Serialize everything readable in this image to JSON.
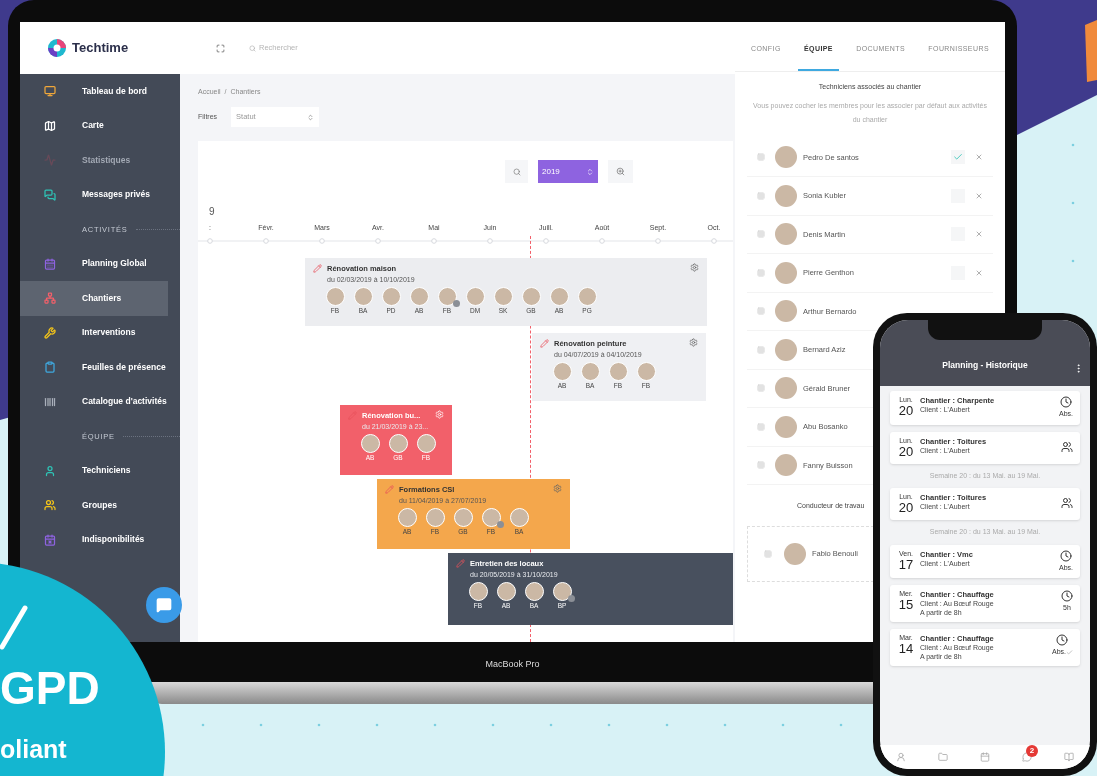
{
  "app": {
    "logo": "Techtime",
    "search_placeholder": "Rechercher"
  },
  "sidebar": {
    "items": [
      {
        "kind": "item",
        "label": "Tableau de bord",
        "selected": false,
        "disabled": false
      },
      {
        "kind": "item",
        "label": "Carte",
        "selected": false,
        "disabled": false
      },
      {
        "kind": "item",
        "label": "Statistiques",
        "selected": false,
        "disabled": true
      },
      {
        "kind": "item",
        "label": "Messages privés",
        "selected": false,
        "disabled": false
      },
      {
        "kind": "section",
        "label": "ACTIVITÉS"
      },
      {
        "kind": "item",
        "label": "Planning Global",
        "selected": false,
        "disabled": false
      },
      {
        "kind": "item",
        "label": "Chantiers",
        "selected": true,
        "disabled": false
      },
      {
        "kind": "item",
        "label": "Interventions",
        "selected": false,
        "disabled": false
      },
      {
        "kind": "item",
        "label": "Feuilles de présence",
        "selected": false,
        "disabled": false
      },
      {
        "kind": "item",
        "label": "Catalogue d'activités",
        "selected": false,
        "disabled": false
      },
      {
        "kind": "section",
        "label": "ÉQUIPE"
      },
      {
        "kind": "item",
        "label": "Techniciens",
        "selected": false,
        "disabled": false
      },
      {
        "kind": "item",
        "label": "Groupes",
        "selected": false,
        "disabled": false
      },
      {
        "kind": "item",
        "label": "Indisponibilités",
        "selected": false,
        "disabled": false
      }
    ]
  },
  "breadcrumb": {
    "items": [
      "Accueil",
      "Chantiers"
    ],
    "separator": "/"
  },
  "filters": {
    "label": "Filtres",
    "select": "Statut"
  },
  "gantt": {
    "year": "2019",
    "year_label": "9",
    "months": [
      ":",
      "Févr.",
      "Mars",
      "Avr.",
      "Mai",
      "Juin",
      "Juill.",
      "Août",
      "Sept.",
      "Oct."
    ],
    "bars": [
      {
        "title": "Rénovation maison",
        "dates": "du 02/03/2019 à 10/10/2019",
        "color": "#ecedf0",
        "gear": true,
        "people": [
          {
            "initials": "FB",
            "badge": false
          },
          {
            "initials": "BA",
            "badge": false
          },
          {
            "initials": "PD",
            "badge": false
          },
          {
            "initials": "AB",
            "badge": false
          },
          {
            "initials": "FB",
            "badge": true
          },
          {
            "initials": "DM",
            "badge": false
          },
          {
            "initials": "SK",
            "badge": false
          },
          {
            "initials": "GB",
            "badge": false
          },
          {
            "initials": "AB",
            "badge": false
          },
          {
            "initials": "PG",
            "badge": false
          }
        ]
      },
      {
        "title": "Rénovation peinture",
        "dates": "du 04/07/2019 à 04/10/2019",
        "color": "#eff0f3",
        "gear": true,
        "people": [
          {
            "initials": "AB",
            "badge": false
          },
          {
            "initials": "BA",
            "badge": false
          },
          {
            "initials": "FB",
            "badge": false
          },
          {
            "initials": "FB",
            "badge": false
          }
        ]
      },
      {
        "title": "Rénovation bu...",
        "dates": "du 21/03/2019 à 23...",
        "color": "#f2606a",
        "gear": true,
        "people": [
          {
            "initials": "AB",
            "badge": false
          },
          {
            "initials": "GB",
            "badge": false
          },
          {
            "initials": "FB",
            "badge": false
          }
        ]
      },
      {
        "title": "Formations CSI",
        "dates": "du 11/04/2019 à 27/07/2019",
        "color": "#f4a74c",
        "gear": true,
        "people": [
          {
            "initials": "AB",
            "badge": false
          },
          {
            "initials": "FB",
            "badge": false
          },
          {
            "initials": "GB",
            "badge": false
          },
          {
            "initials": "FB",
            "badge": true
          },
          {
            "initials": "BA",
            "badge": false
          }
        ]
      },
      {
        "title": "Entretien des locaux",
        "dates": "du 20/05/2019 à 31/10/2019",
        "color": "#48505e",
        "gear": false,
        "people": [
          {
            "initials": "FB",
            "badge": false
          },
          {
            "initials": "AB",
            "badge": false
          },
          {
            "initials": "BA",
            "badge": false
          },
          {
            "initials": "BP",
            "badge": true
          }
        ]
      }
    ]
  },
  "right_panel": {
    "tabs": [
      {
        "label": "CONFIG",
        "selected": false
      },
      {
        "label": "ÉQUIPE",
        "selected": true
      },
      {
        "label": "DOCUMENTS",
        "selected": false
      },
      {
        "label": "FOURNISSEURS",
        "selected": false
      }
    ],
    "heading": "Techniciens associés au chantier",
    "note": "Vous pouvez cocher les membres pour les associer par défaut aux activités du chantier",
    "members": [
      {
        "name": "Pedro De santos",
        "checked": true
      },
      {
        "name": "Sonia Kubler",
        "checked": false
      },
      {
        "name": "Denis Martin",
        "checked": false
      },
      {
        "name": "Pierre Genthon",
        "checked": false
      },
      {
        "name": "Arthur Bernardo"
      },
      {
        "name": "Bernard Aziz"
      },
      {
        "name": "Gérald Bruner"
      },
      {
        "name": "Abu Bosanko"
      },
      {
        "name": "Fanny Buisson"
      }
    ],
    "driver_heading": "Conducteur de travau",
    "driver": "Fabio Benouli"
  },
  "device_label": "MacBook Pro",
  "phone": {
    "title": "Planning - Historique",
    "nav_badge": "2",
    "items": [
      {
        "kind": "card",
        "day": "Lun.",
        "date": "20",
        "title": "Chantier : Charpente",
        "lines": [
          "Client :  L'Aubert"
        ],
        "status": {
          "kind": "clock",
          "label": "Abs.",
          "confirmed": false
        }
      },
      {
        "kind": "card",
        "day": "Lun.",
        "date": "20",
        "title": "Chantier : Toitures",
        "lines": [
          "Client :  L'Aubert"
        ],
        "status": {
          "kind": "person"
        }
      },
      {
        "kind": "week",
        "label": "Semaine 20 : du 13 Mai. au 19 Mai."
      },
      {
        "kind": "card",
        "day": "Lun.",
        "date": "20",
        "title": "Chantier : Toitures",
        "lines": [
          "Client :  L'Aubert"
        ],
        "status": {
          "kind": "person"
        }
      },
      {
        "kind": "week",
        "label": "Semaine 20 : du 13 Mai. au 19 Mai."
      },
      {
        "kind": "card",
        "day": "Ven.",
        "date": "17",
        "title": "Chantier : Vmc",
        "lines": [
          "Client :  L'Aubert"
        ],
        "status": {
          "kind": "clock",
          "label": "Abs.",
          "confirmed": false
        }
      },
      {
        "kind": "card",
        "day": "Mer.",
        "date": "15",
        "title": "Chantier : Chauffage",
        "lines": [
          "Client : Au Bœuf Rouge",
          "A partir de 8h"
        ],
        "status": {
          "kind": "clock",
          "label": "5h",
          "confirmed": false
        }
      },
      {
        "kind": "card",
        "day": "Mar.",
        "date": "14",
        "title": "Chantier : Chauffage",
        "lines": [
          "Client : Au Bœuf Rouge",
          "A partir de 8h"
        ],
        "status": {
          "kind": "clock",
          "label": "Abs.",
          "confirmed": true
        }
      }
    ]
  },
  "rgpd_badge": {
    "title": "GPD",
    "subtitle": "oliant"
  }
}
